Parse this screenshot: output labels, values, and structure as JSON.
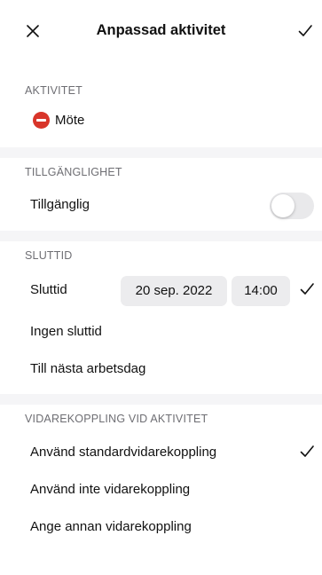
{
  "header": {
    "title": "Anpassad aktivitet"
  },
  "activity": {
    "section_title": "AKTIVITET",
    "status_label": "Möte",
    "status_color": "#d8352a"
  },
  "availability": {
    "section_title": "TILLGÄNGLIGHET",
    "label": "Tillgänglig",
    "enabled": false
  },
  "end_time": {
    "section_title": "SLUTTID",
    "label": "Sluttid",
    "date": "20 sep. 2022",
    "time": "14:00",
    "options": [
      {
        "label": "Ingen sluttid"
      },
      {
        "label": "Till nästa arbetsdag"
      }
    ]
  },
  "forwarding": {
    "section_title": "VIDAREKOPPLING VID AKTIVITET",
    "options": [
      {
        "label": "Använd standardvidarekoppling",
        "selected": true
      },
      {
        "label": "Använd inte vidarekoppling",
        "selected": false
      },
      {
        "label": "Ange annan vidarekoppling",
        "selected": false
      }
    ]
  },
  "colors": {
    "section_band": "#f5f5f7",
    "section_text": "#6e6e73",
    "toggle_off": "#e9e9eb",
    "pill_bg": "#ececee"
  }
}
